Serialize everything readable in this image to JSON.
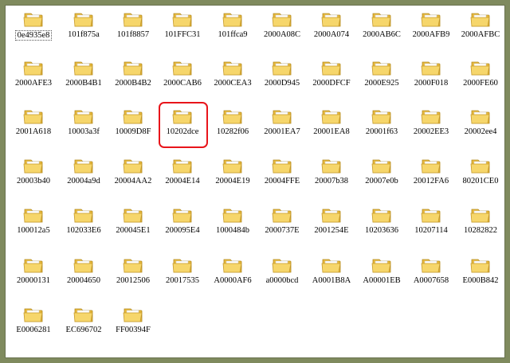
{
  "folder_icon": "folder-icon",
  "colors": {
    "annotation": "#e8141a",
    "folder_front": "#f6d66b",
    "folder_back": "#e8b93c"
  },
  "grid": {
    "rows": [
      [
        "0e4935e8",
        "101f875a",
        "101f8857",
        "101FFC31",
        "101ffca9",
        "2000A08C",
        "2000A074",
        "2000AB6C",
        "2000AFB9",
        "2000AFBC"
      ],
      [
        "2000AFE3",
        "2000B4B1",
        "2000B4B2",
        "2000CAB6",
        "2000CEA3",
        "2000D945",
        "2000DFCF",
        "2000E925",
        "2000F018",
        "2000FE60"
      ],
      [
        "2001A618",
        "10003a3f",
        "10009D8F",
        "10202dce",
        "10282f06",
        "20001EA7",
        "20001EA8",
        "20001f63",
        "20002EE3",
        "20002ee4"
      ],
      [
        "20003b40",
        "20004a9d",
        "20004AA2",
        "20004E14",
        "20004E19",
        "20004FFE",
        "20007b38",
        "20007e0b",
        "20012FA6",
        "80201CE0"
      ],
      [
        "100012a5",
        "102033E6",
        "200045E1",
        "200095E4",
        "1000484b",
        "2000737E",
        "2001254E",
        "10203636",
        "10207114",
        "10282822"
      ],
      [
        "20000131",
        "20004650",
        "20012506",
        "20017535",
        "A0000AF6",
        "a0000bcd",
        "A0001B8A",
        "A00001EB",
        "A0007658",
        "E000B842"
      ],
      [
        "E0006281",
        "EC696702",
        "FF00394F"
      ]
    ]
  },
  "focused_item": "0e4935e8",
  "highlighted_item": "10202dce"
}
